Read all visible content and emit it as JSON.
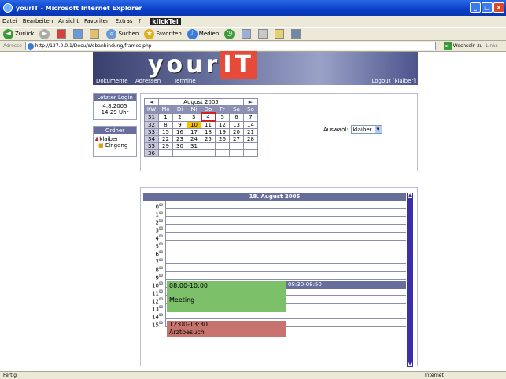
{
  "window": {
    "title": "yourIT - Microsoft Internet Explorer"
  },
  "menu": [
    "Datei",
    "Bearbeiten",
    "Ansicht",
    "Favoriten",
    "Extras",
    "?"
  ],
  "menu_brand": "klickTel",
  "toolbar": {
    "back": "Zurück",
    "search": "Suchen",
    "favorites": "Favoriten",
    "media": "Medien"
  },
  "address": {
    "label": "Adresse",
    "url": "http://127.0.0.1/Docu/Webanbindung/frames.php",
    "go": "Wechseln zu",
    "links": "Links"
  },
  "status": {
    "left": "Fertig",
    "right": "Internet"
  },
  "site": {
    "logo_a": "your",
    "logo_b": "IT",
    "nav": [
      "Dokumente",
      "Adressen",
      "Termine"
    ],
    "logout": "Logout [klaiber]"
  },
  "login": {
    "title": "Letzter Login",
    "date": "4.8.2005",
    "time": "14:29 Uhr"
  },
  "ordner": {
    "title": "Ordner",
    "user": "klaiber",
    "inbox": "Eingang"
  },
  "calendar": {
    "month": "August 2005",
    "prev": "◄",
    "next": "►",
    "headers": [
      "KW",
      "Mo",
      "Di",
      "Mi",
      "Do",
      "Fr",
      "Sa",
      "So"
    ],
    "weeks": [
      [
        "31",
        "1",
        "2",
        "3",
        "4",
        "5",
        "6",
        "7"
      ],
      [
        "32",
        "8",
        "9",
        "10",
        "11",
        "12",
        "13",
        "14"
      ],
      [
        "33",
        "15",
        "16",
        "17",
        "18",
        "19",
        "20",
        "21"
      ],
      [
        "34",
        "22",
        "23",
        "24",
        "25",
        "26",
        "27",
        "28"
      ],
      [
        "35",
        "29",
        "30",
        "31",
        "",
        "",
        "",
        ""
      ],
      [
        "36",
        "",
        "",
        "",
        "",
        "",
        "",
        ""
      ]
    ]
  },
  "auswahl": {
    "label": "Auswahl:",
    "value": "klaiber"
  },
  "day": {
    "title": "18. August 2005",
    "hours": [
      "0",
      "1",
      "2",
      "3",
      "4",
      "5",
      "6",
      "7",
      "8",
      "9",
      "10",
      "11",
      "12",
      "13",
      "14",
      "15"
    ],
    "minute": "00",
    "events": [
      {
        "time": "08:00-10:00",
        "title": "Meeting"
      },
      {
        "time": "08:30-08:50",
        "title": ""
      },
      {
        "time": "12:00-13:30",
        "title": "Arztbesuch"
      }
    ]
  },
  "colors": {
    "banner": "#686e9c",
    "meeting": "#7cc06a",
    "arzt": "#c7736e",
    "today": "#f2c200"
  }
}
